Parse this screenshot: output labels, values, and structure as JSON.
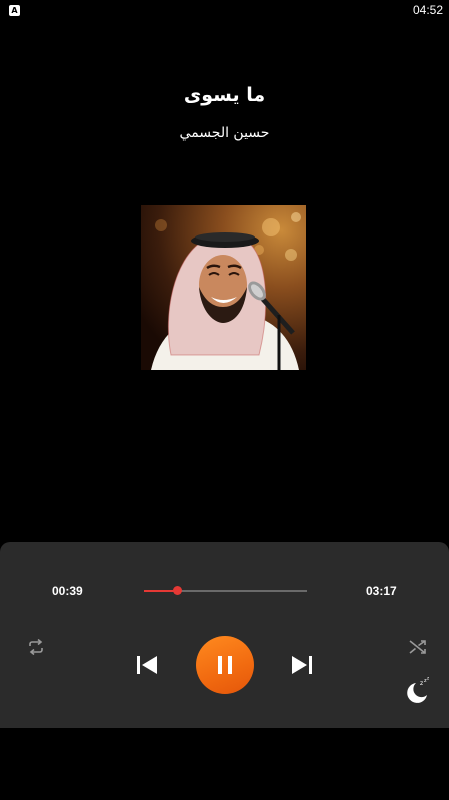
{
  "status_bar": {
    "app_icon_letter": "A",
    "time": "04:52"
  },
  "track": {
    "title": "ما يسوى",
    "artist": "حسين الجسمي"
  },
  "album_art": {
    "icon": "album-art-image"
  },
  "player": {
    "current_time": "00:39",
    "total_time": "03:17",
    "progress_fraction": 0.2,
    "state": "playing",
    "accent_color": "#e53935",
    "play_button_color": "#f57c1f",
    "icons": {
      "repeat": "repeat-icon",
      "shuffle": "shuffle-icon",
      "previous": "skip-previous-icon",
      "next": "skip-next-icon",
      "pause": "pause-icon",
      "sleep_timer": "sleep-timer-icon"
    }
  }
}
